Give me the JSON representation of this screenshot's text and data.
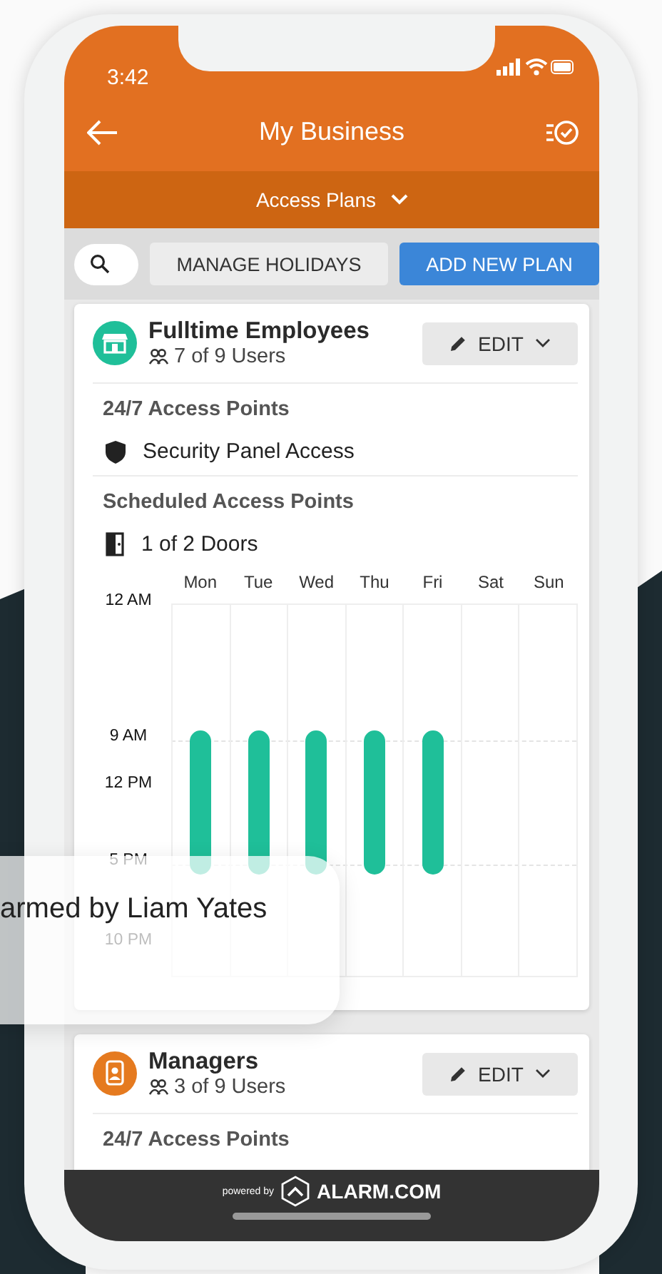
{
  "status_bar": {
    "time": "3:42"
  },
  "header": {
    "title": "My Business"
  },
  "subheader": {
    "label": "Access Plans"
  },
  "toolbar": {
    "buttons": [
      {
        "label": "MANAGE HOLIDAYS",
        "kind": "secondary"
      },
      {
        "label": "ADD NEW PLAN",
        "kind": "primary"
      }
    ]
  },
  "plans": [
    {
      "name": "Fulltime Employees",
      "users": "7 of 9 Users",
      "kind": "store",
      "color": "#1fbf99",
      "edit_label": "EDIT",
      "sections": [
        {
          "title": "24/7 Access Points",
          "items": [
            {
              "kind": "shield",
              "label": "Security Panel Access"
            }
          ]
        },
        {
          "title": "Scheduled Access Points",
          "items": [
            {
              "kind": "door",
              "label": "1 of 2 Doors"
            }
          ],
          "schedule": {
            "times": [
              "12 AM",
              "9 AM",
              "12 PM",
              "5 PM",
              "10 PM"
            ],
            "days": [
              {
                "label": "Mon",
                "scheduled": true
              },
              {
                "label": "Tue",
                "scheduled": true
              },
              {
                "label": "Wed",
                "scheduled": true
              },
              {
                "label": "Thu",
                "scheduled": true
              },
              {
                "label": "Fri",
                "scheduled": true
              },
              {
                "label": "Sat",
                "scheduled": false
              },
              {
                "label": "Sun",
                "scheduled": false
              }
            ]
          }
        }
      ]
    },
    {
      "name": "Managers",
      "users": "3 of 9 Users",
      "kind": "badge",
      "color": "#e57a1f",
      "edit_label": "EDIT",
      "sections": [
        {
          "title": "24/7 Access Points"
        }
      ]
    }
  ],
  "notification": {
    "text": "armed by Liam Yates"
  },
  "footer": {
    "powered_by": "powered by",
    "brand": "ALARM.COM"
  }
}
